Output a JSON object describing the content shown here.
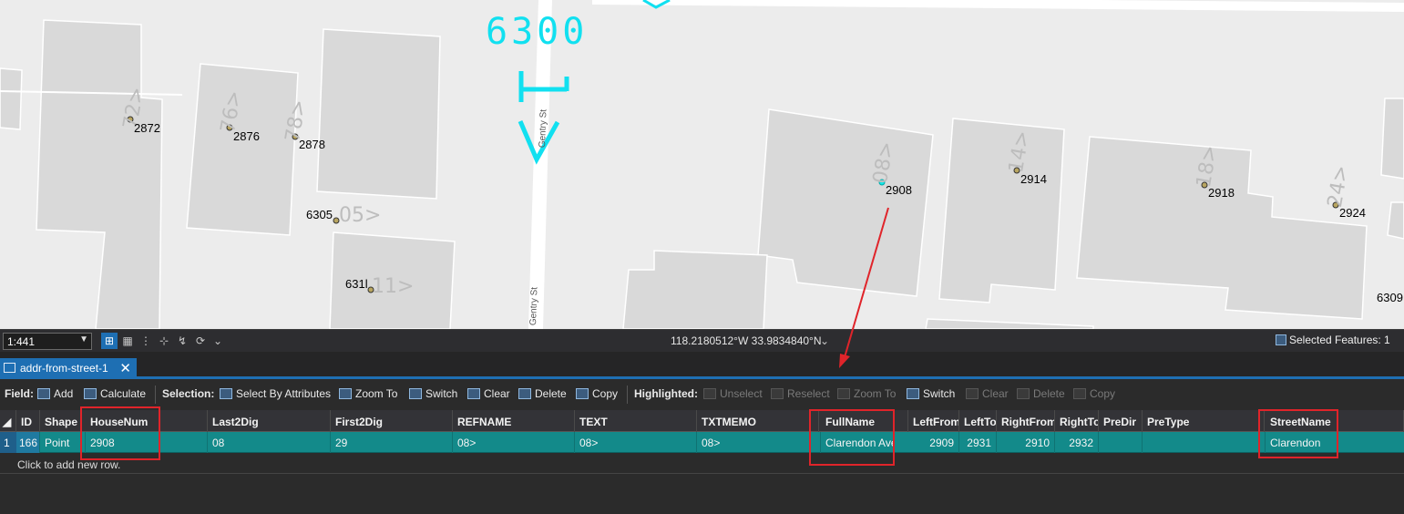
{
  "map": {
    "big_label": "6300",
    "street_labels": [
      "Gentry St",
      "Gentry St"
    ],
    "addresses": [
      {
        "num": "2872"
      },
      {
        "num": "2876"
      },
      {
        "num": "2878"
      },
      {
        "num": "6305"
      },
      {
        "num": "631l"
      },
      {
        "num": "2908"
      },
      {
        "num": "2914"
      },
      {
        "num": "2918"
      },
      {
        "num": "2924"
      },
      {
        "num": "6309"
      }
    ],
    "ghost_labels": [
      "72>",
      "76>",
      "78>",
      "05>",
      "11>",
      "08>",
      "14>",
      "18>",
      "24>"
    ]
  },
  "statusbar": {
    "scale": "1:441",
    "coordinates": "118.2180512°W 33.9834840°N",
    "selected_features": "Selected Features: 1"
  },
  "tab": {
    "title": "addr-from-street-1"
  },
  "toolbar": {
    "field_label": "Field:",
    "add": "Add",
    "calculate": "Calculate",
    "selection_label": "Selection:",
    "select_by_attributes": "Select By Attributes",
    "zoom_to": "Zoom To",
    "switch": "Switch",
    "clear": "Clear",
    "delete": "Delete",
    "copy": "Copy",
    "highlighted_label": "Highlighted:",
    "unselect": "Unselect",
    "reselect": "Reselect",
    "zoom_to_h": "Zoom To",
    "switch_h": "Switch",
    "clear_h": "Clear",
    "delete_h": "Delete",
    "copy_h": "Copy"
  },
  "table": {
    "columns": [
      "ID",
      "Shape",
      "HouseNum",
      "Last2Dig",
      "First2Dig",
      "REFNAME",
      "TEXT",
      "TXTMEMO",
      "FullName",
      "LeftFrom",
      "LeftTo",
      "RightFrom",
      "RightTo",
      "PreDir",
      "PreType",
      "StreetName"
    ],
    "row_number": "1",
    "row": [
      "166",
      "Point",
      "2908",
      "08",
      "29",
      "08>",
      "08>",
      "08>",
      "Clarendon Ave",
      "2909",
      "2931",
      "2910",
      "2932",
      "",
      "",
      "Clarendon"
    ],
    "new_row_text": "Click to add new row."
  },
  "colors": {
    "accent": "#1e6fb3",
    "selected_row": "#138a8a",
    "highlight_box": "#e0242a",
    "cyan_markup": "#11e0f0"
  }
}
